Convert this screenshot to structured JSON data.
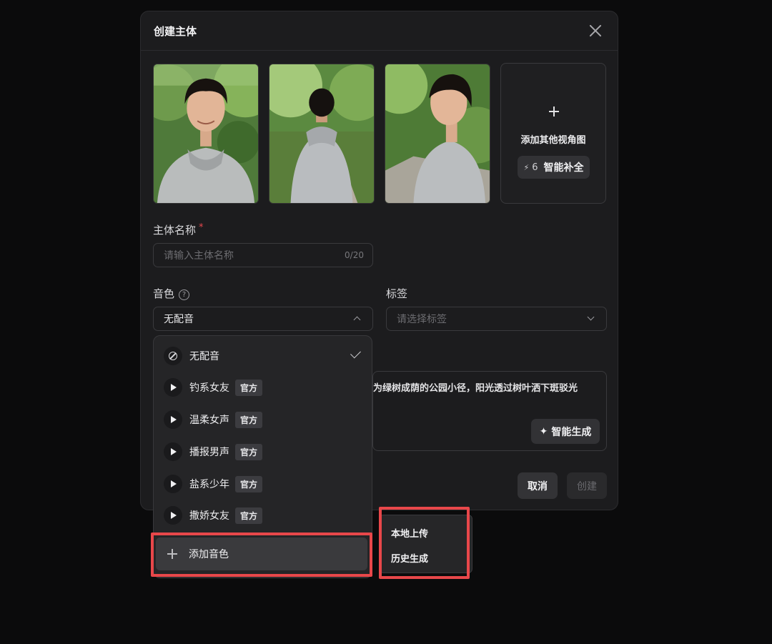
{
  "modal": {
    "title": "创建主体"
  },
  "images": [
    {
      "name": "front-view",
      "desc": "boy facing camera in grey hoodie"
    },
    {
      "name": "back-view",
      "desc": "boy seen from behind on park path"
    },
    {
      "name": "side-view",
      "desc": "boy in profile smiling"
    }
  ],
  "add_view": {
    "label": "添加其他视角图",
    "smart_fill_cost": "6",
    "smart_fill_label": "智能补全"
  },
  "name_field": {
    "label": "主体名称",
    "required_mark": "*",
    "placeholder": "请输入主体名称",
    "counter": "0/20"
  },
  "voice": {
    "label": "音色",
    "help_glyph": "?",
    "selected": "无配音"
  },
  "tags": {
    "label": "标签",
    "placeholder": "请选择标签"
  },
  "description": {
    "text": "为绿树成荫的公园小径，阳光透过树叶洒下斑驳光",
    "generate_label": "智能生成"
  },
  "buttons": {
    "cancel": "取消",
    "create": "创建"
  },
  "voice_dropdown": {
    "none_label": "无配音",
    "official_tag": "官方",
    "items": [
      {
        "label": "钓系女友"
      },
      {
        "label": "温柔女声"
      },
      {
        "label": "播报男声"
      },
      {
        "label": "盐系少年"
      },
      {
        "label": "撒娇女友"
      }
    ],
    "add_label": "添加音色"
  },
  "add_voice_menu": {
    "upload": "本地上传",
    "history": "历史生成"
  }
}
